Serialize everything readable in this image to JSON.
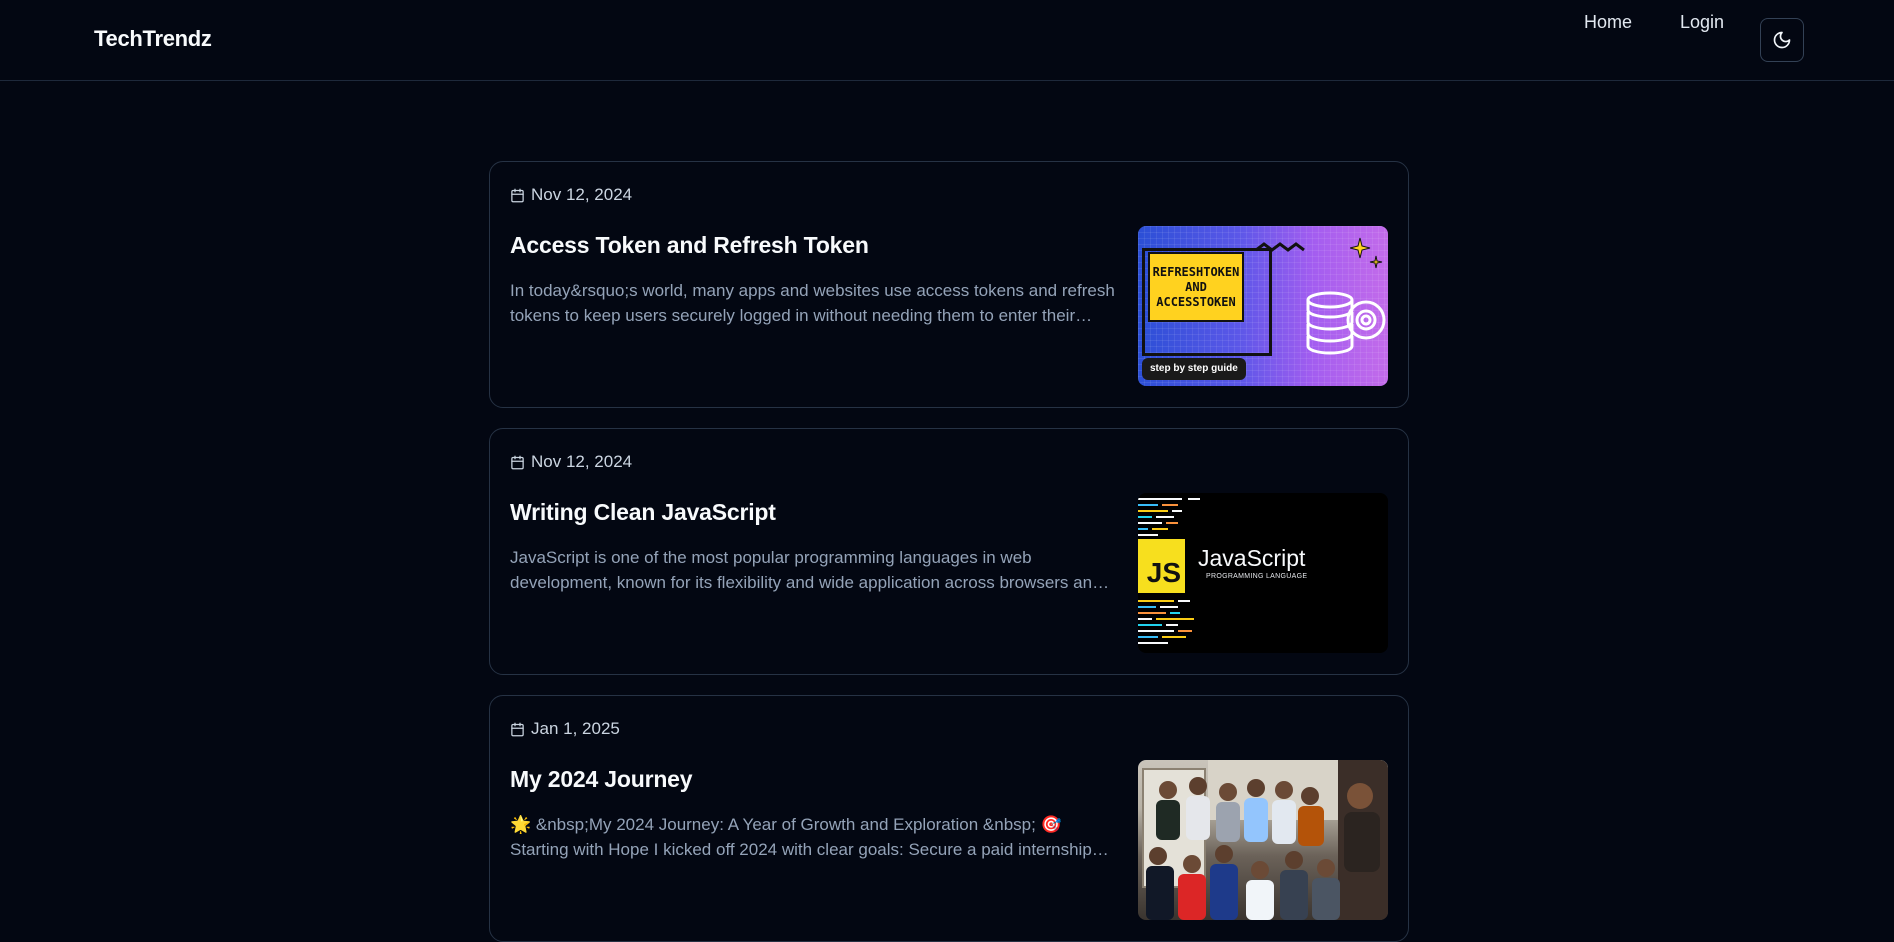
{
  "nav": {
    "brand": "TechTrendz",
    "links": [
      {
        "label": "Home"
      },
      {
        "label": "Login"
      }
    ],
    "theme_toggle_icon": "moon-icon"
  },
  "posts": [
    {
      "date": "Nov 12, 2024",
      "title": "Access Token and Refresh Token",
      "excerpt": "In today&rsquo;s world, many apps and websites use access tokens and refresh tokens to keep users securely logged in without needing them to enter their credentials again and again.",
      "thumbnail": {
        "heading_line1": "REFRESHTOKEN",
        "heading_line2": "AND",
        "heading_line3": "ACCESSTOKEN",
        "badge": "step by step guide"
      }
    },
    {
      "date": "Nov 12, 2024",
      "title": "Writing Clean JavaScript",
      "excerpt": "JavaScript is one of the most popular programming languages in web development, known for its flexibility and wide application across browsers and servers.",
      "thumbnail": {
        "logo": "JS",
        "title": "JavaScript",
        "subtitle": "PROGRAMMING LANGUAGE"
      }
    },
    {
      "date": "Jan 1, 2025",
      "title": "My 2024 Journey",
      "excerpt": "🌟 &nbsp;My 2024 Journey: A Year of Growth and Exploration &nbsp; 🎯 Starting with Hope I kicked off 2024 with clear goals: Secure a paid internship and keep learning.",
      "thumbnail": {}
    }
  ],
  "colors": {
    "background": "#030712",
    "border": "#263244",
    "text_primary": "#f8fafc",
    "text_secondary": "#94a3b8"
  }
}
